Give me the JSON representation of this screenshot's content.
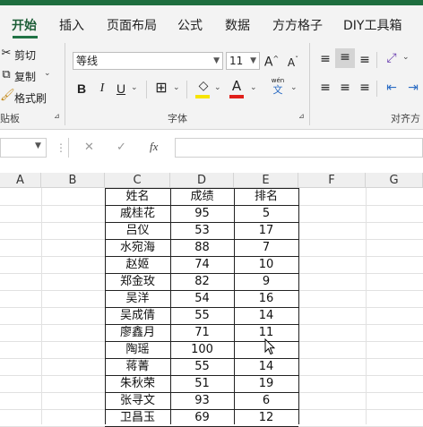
{
  "tabs": [
    {
      "label": "开始",
      "active": true
    },
    {
      "label": "插入"
    },
    {
      "label": "页面布局"
    },
    {
      "label": "公式"
    },
    {
      "label": "数据"
    },
    {
      "label": "方方格子"
    },
    {
      "label": "DIY工具箱"
    }
  ],
  "clipboard": {
    "cut_label": "剪切",
    "copy_label": "复制",
    "format_painter_label": "格式刷",
    "group_label": "贴板"
  },
  "font": {
    "name": "等线",
    "size": "11",
    "group_label": "字体",
    "grow_glyph": "A",
    "shrink_glyph": "A",
    "bold": "B",
    "italic": "I",
    "underline": "U",
    "font_color_glyph": "A",
    "phonetic_top": "wén",
    "phonetic_bottom": "文",
    "fill_color": "#f7e400",
    "font_color": "#e0201b"
  },
  "alignment": {
    "group_label": "对齐方"
  },
  "formula_bar": {
    "fx_label": "fx",
    "cancel_glyph": "✕",
    "enter_glyph": "✓",
    "value": ""
  },
  "sheet": {
    "columns": [
      "A",
      "B",
      "C",
      "D",
      "E",
      "F",
      "G"
    ],
    "header_row": [
      "姓名",
      "成绩",
      "排名"
    ],
    "rows": [
      [
        "戚桂花",
        "95",
        "5"
      ],
      [
        "吕仪",
        "53",
        "17"
      ],
      [
        "水宛海",
        "88",
        "7"
      ],
      [
        "赵姬",
        "74",
        "10"
      ],
      [
        "郑金玫",
        "82",
        "9"
      ],
      [
        "吴洋",
        "54",
        "16"
      ],
      [
        "吴成倩",
        "55",
        "14"
      ],
      [
        "廖鑫月",
        "71",
        "11"
      ],
      [
        "陶瑶",
        "100",
        ""
      ],
      [
        "蒋菁",
        "55",
        "14"
      ],
      [
        "朱秋荣",
        "51",
        "19"
      ],
      [
        "张寻文",
        "93",
        "6"
      ],
      [
        "卫昌玉",
        "69",
        "12"
      ]
    ]
  }
}
